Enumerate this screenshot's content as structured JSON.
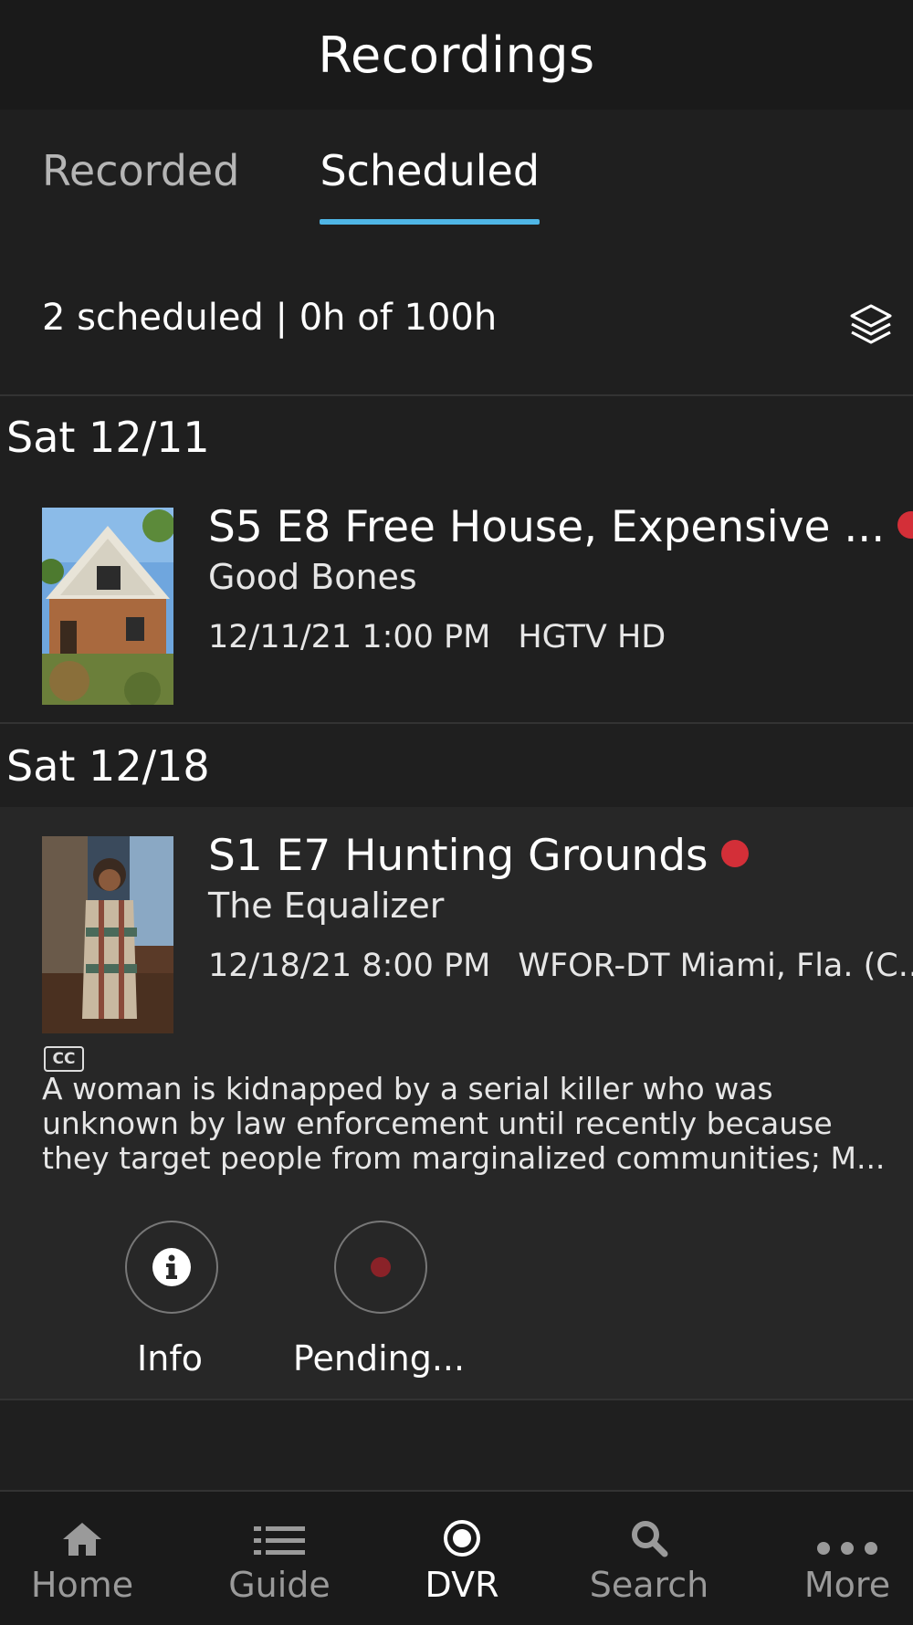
{
  "header": {
    "title": "Recordings"
  },
  "tabs": [
    {
      "label": "Recorded",
      "active": false
    },
    {
      "label": "Scheduled",
      "active": true
    }
  ],
  "summary": {
    "text": "2 scheduled | 0h of 100h"
  },
  "groups": [
    {
      "date": "Sat 12/11",
      "item": {
        "title": "S5 E8 Free House, Expensive ...",
        "show": "Good Bones",
        "datetime": "12/11/21 1:00 PM",
        "channel": "HGTV HD",
        "status_color": "#d32f38"
      }
    },
    {
      "date": "Sat 12/18",
      "item": {
        "title": "S1 E7 Hunting Grounds",
        "show": "The Equalizer",
        "datetime": "12/18/21 8:00 PM",
        "channel": "WFOR-DT Miami, Fla. (C...",
        "status_color": "#d32f38",
        "cc_label": "CC",
        "description": "A woman is kidnapped by a serial killer who was unknown by law enforcement until recently because they target people from marginalized communities; M...",
        "actions": [
          {
            "label": "Info",
            "icon": "info-icon"
          },
          {
            "label": "Pending...",
            "icon": "record-icon"
          }
        ]
      }
    }
  ],
  "nav": [
    {
      "label": "Home",
      "icon": "home-icon",
      "active": false
    },
    {
      "label": "Guide",
      "icon": "guide-list-icon",
      "active": false
    },
    {
      "label": "DVR",
      "icon": "dvr-record-icon",
      "active": true
    },
    {
      "label": "Search",
      "icon": "search-icon",
      "active": false
    },
    {
      "label": "More",
      "icon": "more-dots-icon",
      "active": false
    }
  ],
  "colors": {
    "accent": "#4fb6e6",
    "record": "#d32f38",
    "background": "#1f1f1f"
  }
}
